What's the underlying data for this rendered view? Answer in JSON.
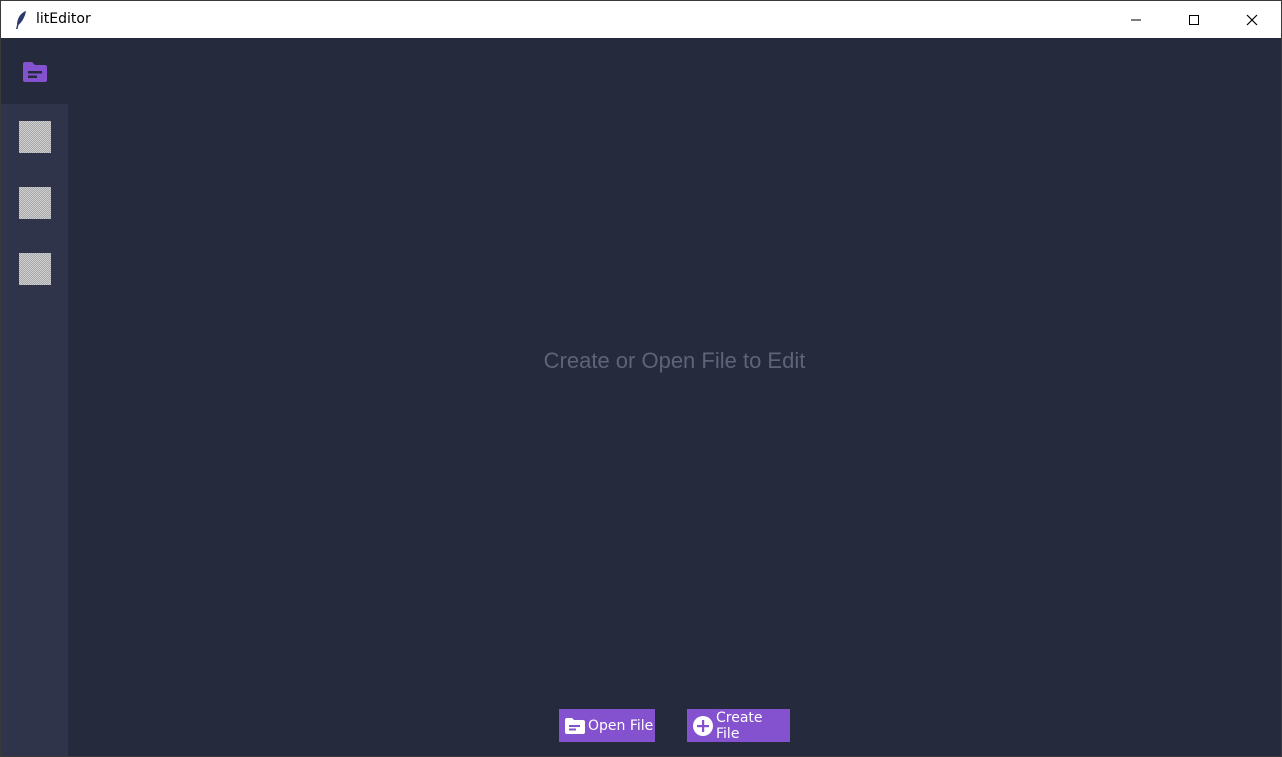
{
  "window": {
    "title": "litEditor",
    "icon": "feather-icon",
    "controls": {
      "minimize": "minimize-icon",
      "maximize": "maximize-icon",
      "close": "close-icon"
    }
  },
  "sidebar": {
    "top_icon": "folder-icon",
    "items": [
      {
        "icon": "missing-image-icon"
      },
      {
        "icon": "missing-image-icon"
      },
      {
        "icon": "missing-image-icon"
      }
    ]
  },
  "editor": {
    "empty_message": "Create or Open File to Edit"
  },
  "actions": {
    "open_label": "Open File",
    "open_icon": "folder-icon",
    "create_label": "Create File",
    "create_icon": "plus-circle-icon"
  },
  "colors": {
    "accent": "#8452cf",
    "background": "#252a3d",
    "sidebar": "#2f344a",
    "muted_text": "#5e6478"
  }
}
